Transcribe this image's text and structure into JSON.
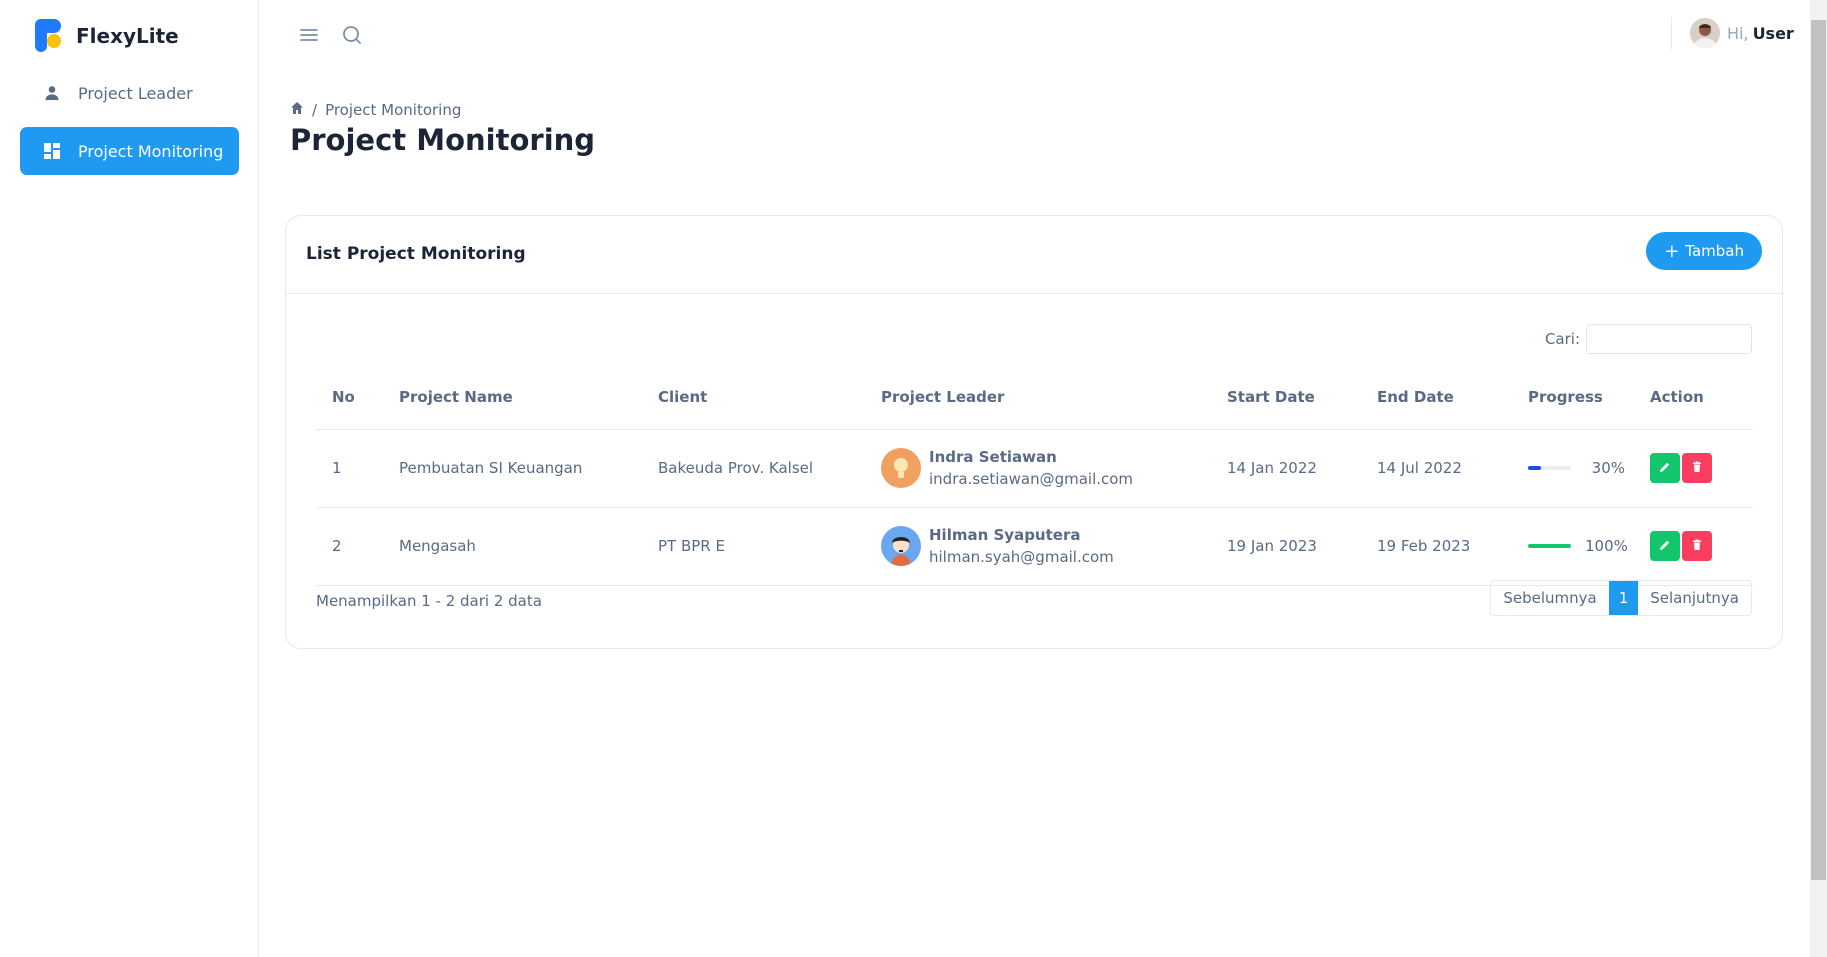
{
  "brand": {
    "name": "FlexyLite"
  },
  "sidebar": {
    "items": [
      {
        "label": "Project Leader",
        "icon": "person-icon",
        "active": false
      },
      {
        "label": "Project Monitoring",
        "icon": "dashboard-icon",
        "active": true
      }
    ]
  },
  "topbar": {
    "greeting": "Hi,",
    "user_name": "User"
  },
  "breadcrumb": {
    "current": "Project Monitoring",
    "separator": "/"
  },
  "page": {
    "title": "Project Monitoring"
  },
  "card": {
    "title": "List Project Monitoring",
    "add_label": "Tambah",
    "search_label": "Cari:",
    "search_value": ""
  },
  "table": {
    "headers": [
      "No",
      "Project Name",
      "Client",
      "Project Leader",
      "Start Date",
      "End Date",
      "Progress",
      "Action"
    ],
    "rows": [
      {
        "no": "1",
        "project": "Pembuatan SI Keuangan",
        "client": "Bakeuda Prov. Kalsel",
        "leader_name": "Indra Setiawan",
        "leader_email": "indra.setiawan@gmail.com",
        "start": "14 Jan 2022",
        "end": "14 Jul 2022",
        "progress": "30%",
        "progress_value": 30,
        "progress_color": "#1e4fd8"
      },
      {
        "no": "2",
        "project": "Mengasah",
        "client": "PT BPR E",
        "leader_name": "Hilman Syaputera",
        "leader_email": "hilman.syah@gmail.com",
        "start": "19 Jan 2023",
        "end": "19 Feb 2023",
        "progress": "100%",
        "progress_value": 100,
        "progress_color": "#13c56b"
      }
    ]
  },
  "footer": {
    "info": "Menampilkan 1 - 2 dari 2 data",
    "prev": "Sebelumnya",
    "page": "1",
    "next": "Selanjutnya"
  },
  "colors": {
    "primary": "#1e9bf0",
    "success": "#13c56b",
    "danger": "#fa3e60"
  }
}
